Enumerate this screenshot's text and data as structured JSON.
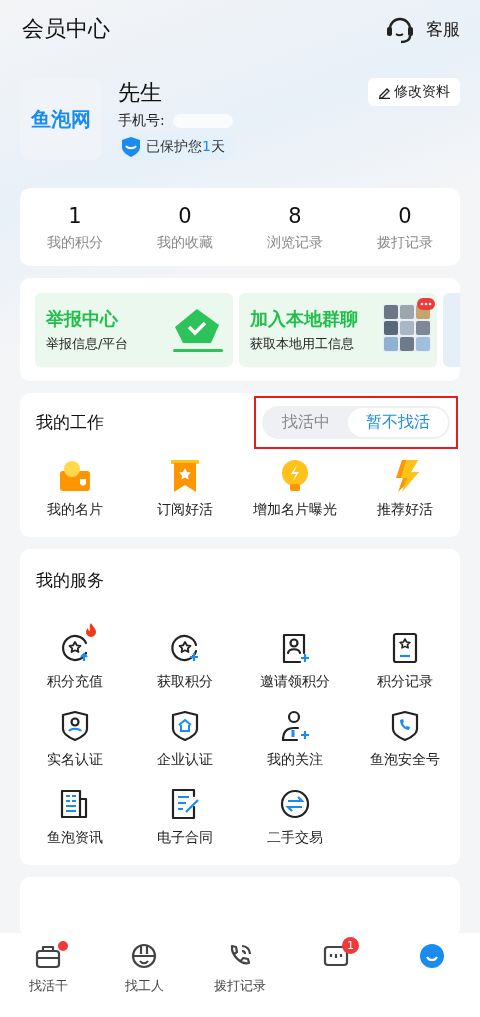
{
  "header": {
    "title": "会员中心",
    "service_label": "客服"
  },
  "profile": {
    "logo_text": "鱼泡网",
    "name": "先生",
    "phone_label": "手机号:",
    "protect_prefix": "已保护您",
    "protect_days": "1",
    "protect_suffix": "天",
    "edit_label": "修改资料"
  },
  "stats": [
    {
      "value": "1",
      "label": "我的积分"
    },
    {
      "value": "0",
      "label": "我的收藏"
    },
    {
      "value": "8",
      "label": "浏览记录"
    },
    {
      "value": "0",
      "label": "拨打记录"
    }
  ],
  "banners": [
    {
      "kind": "report",
      "title": "举报中心",
      "subtitle": "举报信息/平台"
    },
    {
      "kind": "group",
      "title": "加入本地群聊",
      "subtitle": "获取本地用工信息"
    }
  ],
  "work": {
    "title": "我的工作",
    "highlighted": true,
    "toggle": [
      {
        "label": "找活中",
        "selected": false
      },
      {
        "label": "暂不找活",
        "selected": true
      }
    ],
    "items": [
      {
        "kind": "card",
        "label": "我的名片"
      },
      {
        "kind": "ribbon",
        "label": "订阅好活"
      },
      {
        "kind": "bulb",
        "label": "增加名片曝光"
      },
      {
        "kind": "bolt",
        "label": "推荐好活"
      }
    ]
  },
  "services": {
    "title": "我的服务",
    "items": [
      {
        "kind": "coin-up",
        "label": "积分充值",
        "hot": true
      },
      {
        "kind": "coin-plus",
        "label": "获取积分",
        "hot": false
      },
      {
        "kind": "invite",
        "label": "邀请领积分",
        "hot": false
      },
      {
        "kind": "record",
        "label": "积分记录",
        "hot": false
      },
      {
        "kind": "shield-person",
        "label": "实名认证",
        "hot": false
      },
      {
        "kind": "shield-company",
        "label": "企业认证",
        "hot": false
      },
      {
        "kind": "follow",
        "label": "我的关注",
        "hot": false
      },
      {
        "kind": "shield-phone",
        "label": "鱼泡安全号",
        "hot": false
      },
      {
        "kind": "news",
        "label": "鱼泡资讯",
        "hot": false
      },
      {
        "kind": "contract",
        "label": "电子合同",
        "hot": false
      },
      {
        "kind": "exchange",
        "label": "二手交易",
        "hot": false
      }
    ]
  },
  "tabbar": [
    {
      "kind": "bag",
      "label": "找活干",
      "selected": false,
      "dot": true
    },
    {
      "kind": "helmet",
      "label": "找工人",
      "selected": false
    },
    {
      "kind": "phone",
      "label": "拨打记录",
      "selected": false
    },
    {
      "kind": "message",
      "selected": false,
      "badge": "1"
    },
    {
      "kind": "face",
      "selected": true
    }
  ]
}
